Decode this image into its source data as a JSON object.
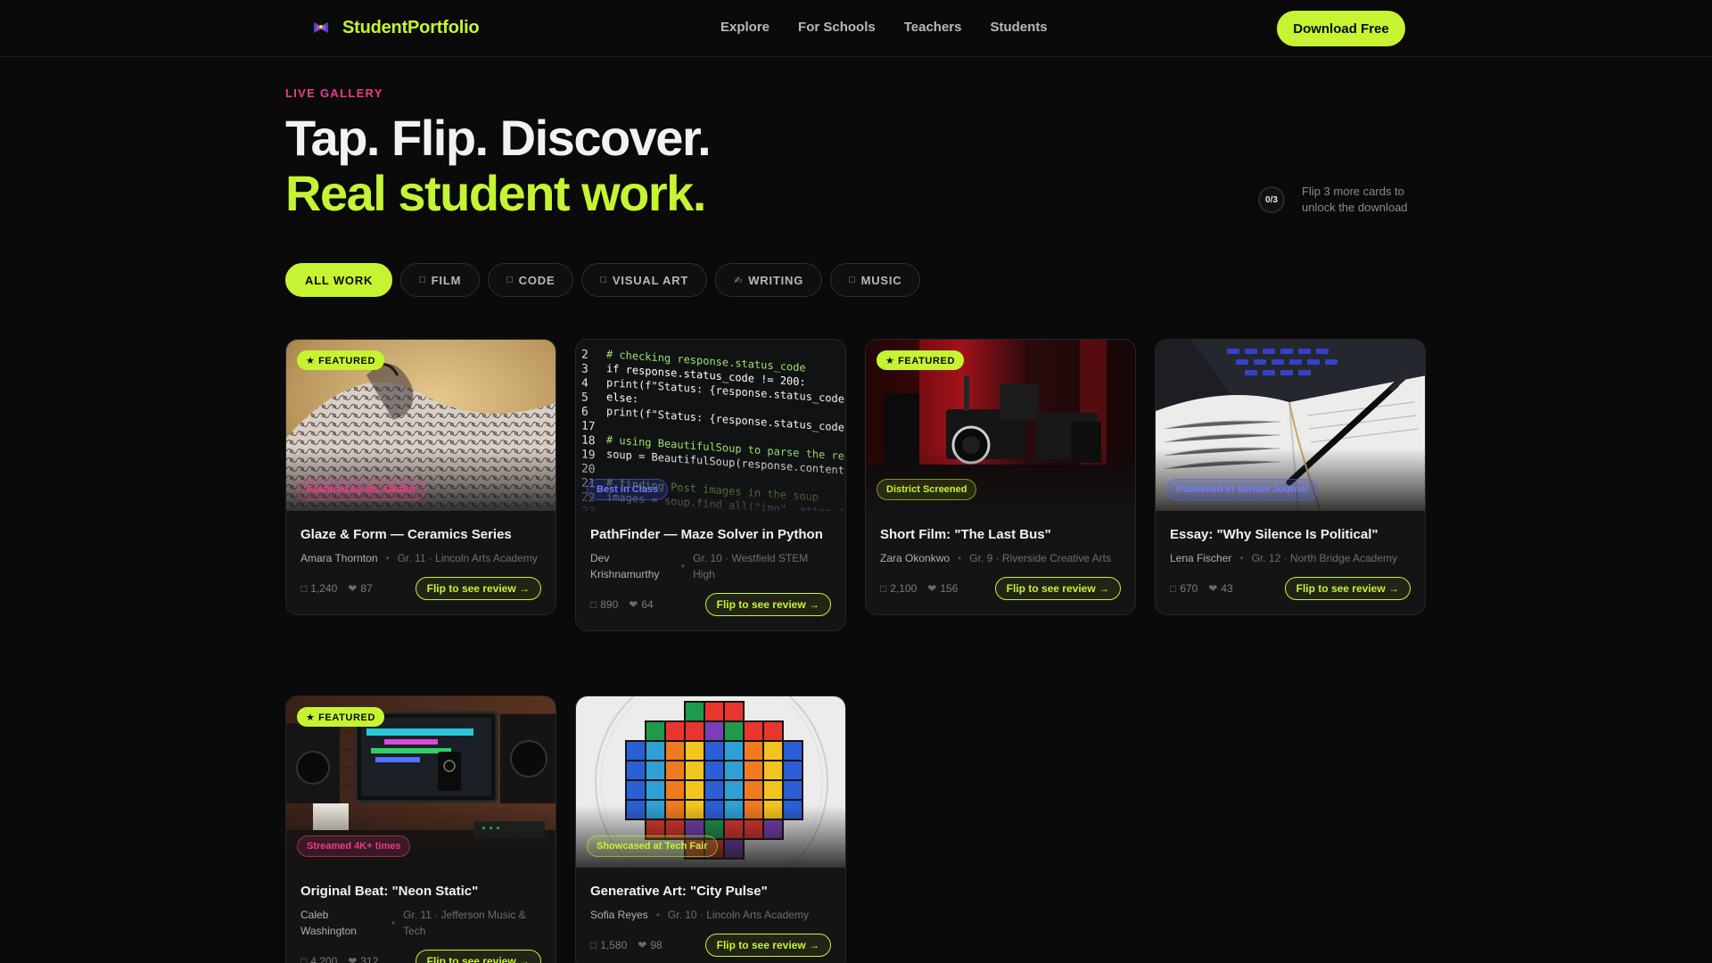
{
  "nav": {
    "brand": "StudentPortfolio",
    "links": [
      "Explore",
      "For Schools",
      "Teachers",
      "Students"
    ],
    "cta": "Download Free"
  },
  "hero": {
    "eyebrow": "LIVE GALLERY",
    "line1": "Tap. Flip. Discover.",
    "line2": "Real student work."
  },
  "unlock": {
    "progress": "0/3",
    "text": "Flip 3 more cards to unlock the download"
  },
  "filters": [
    {
      "label": "ALL WORK",
      "icon": ""
    },
    {
      "label": "FILM",
      "icon": "□"
    },
    {
      "label": "CODE",
      "icon": "□"
    },
    {
      "label": "VISUAL ART",
      "icon": "□"
    },
    {
      "label": "WRITING",
      "icon": "✍"
    },
    {
      "label": "MUSIC",
      "icon": "□"
    }
  ],
  "featured_label": "★ FEATURED",
  "cards": [
    {
      "title": "Glaze & Form — Ceramics Series",
      "author": "Amara Thornton",
      "school": "Gr. 11 · Lincoln Arts Academy",
      "views": "1,240",
      "likes": "87",
      "badge": "Featured by Ms. Okafor",
      "featured": true,
      "cta": "Flip to see review →"
    },
    {
      "title": "PathFinder — Maze Solver in Python",
      "author": "Dev Krishnamurthy",
      "school": "Gr. 10 · Westfield STEM High",
      "views": "890",
      "likes": "64",
      "badge": "Best in Class",
      "featured": false,
      "cta": "Flip to see review →"
    },
    {
      "title": "Short Film: \"The Last Bus\"",
      "author": "Zara Okonkwo",
      "school": "Gr. 9 · Riverside Creative Arts",
      "views": "2,100",
      "likes": "156",
      "badge": "District Screened",
      "featured": true,
      "cta": "Flip to see review →"
    },
    {
      "title": "Essay: \"Why Silence Is Political\"",
      "author": "Lena Fischer",
      "school": "Gr. 12 · North Bridge Academy",
      "views": "670",
      "likes": "43",
      "badge": "Published in School Journal",
      "featured": false,
      "cta": "Flip to see review →"
    },
    {
      "title": "Original Beat: \"Neon Static\"",
      "author": "Caleb Washington",
      "school": "Gr. 11 · Jefferson Music & Tech",
      "views": "4,200",
      "likes": "312",
      "badge": "Streamed 4K+ times",
      "featured": true,
      "cta": "Flip to see review →"
    },
    {
      "title": "Generative Art: \"City Pulse\"",
      "author": "Sofia Reyes",
      "school": "Gr. 10 · Lincoln Arts Academy",
      "views": "1,580",
      "likes": "98",
      "badge": "Showcased at Tech Fair",
      "featured": false,
      "cta": "Flip to see review →"
    }
  ],
  "code_lines": [
    "# checking response.status_code",
    "if response.status_code != 200:",
    "    print(f\"Status: {response.status_code}\")",
    "else:",
    "    print(f\"Status: {response.status_code}\")",
    "",
    "# using BeautifulSoup to parse the response",
    "soup = BeautifulSoup(response.content, \"html.parser\")",
    "",
    "# finding Post images in the soup",
    "images = soup.find_all(\"img\", attrs={\"alt\": \"Post image\"})"
  ],
  "code_line_numbers": [
    "2",
    "3",
    "4",
    "5",
    "6",
    "17",
    "18",
    "19",
    "20",
    "21",
    "22",
    "23"
  ],
  "colors": {
    "accent": "#c6f432",
    "pink": "#f0398b",
    "blue": "#6f7dff",
    "bg": "#0a0a0a"
  }
}
